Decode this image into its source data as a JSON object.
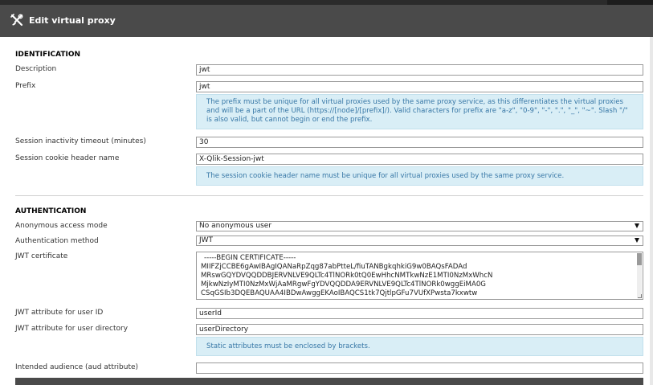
{
  "window": {
    "title": "Edit virtual proxy"
  },
  "identification": {
    "header": "IDENTIFICATION",
    "description_label": "Description",
    "description_value": "jwt",
    "prefix_label": "Prefix",
    "prefix_value": "jwt",
    "prefix_info": "The prefix must be unique for all virtual proxies used by the same proxy service, as this differentiates the virtual proxies and will be a part of the URL (https://[node]/[prefix]/). Valid characters for prefix are \"a-z\", \"0-9\", \"-\", \".\", \"_\", \"~\". Slash \"/\" is also valid, but cannot begin or end the prefix.",
    "session_timeout_label": "Session inactivity timeout (minutes)",
    "session_timeout_value": "30",
    "cookie_header_label": "Session cookie header name",
    "cookie_header_value": "X-Qlik-Session-jwt",
    "cookie_header_info": "The session cookie header name must be unique for all virtual proxies used by the same proxy service."
  },
  "authentication": {
    "header": "AUTHENTICATION",
    "anonymous_label": "Anonymous access mode",
    "anonymous_value": "No anonymous user",
    "method_label": "Authentication method",
    "method_value": "JWT",
    "certificate_label": "JWT certificate",
    "certificate_lines": [
      "-----BEGIN CERTIFICATE-----",
      "MIIFZjCCBE6gAwIBAgIQANaRpZqg87abPtteL/fiuTANBgkqhkiG9w0BAQsFADAd",
      "MRswGQYDVQQDDBJERVNLVE9QLTc4TlNORk0tQ0EwHhcNMTkwNzE1MTI0NzMxWhcN",
      "MjkwNzIyMTI0NzMxWjAaMRgwFgYDVQQDDA9ERVNLVE9QLTc4TlNORk0wggEiMA0G",
      "CSqGSIb3DQEBAQUAA4IBDwAwggEKAoIBAQCS1tk7QjtlpGFu7VUfXPwsta7kxwtw"
    ],
    "user_id_label": "JWT attribute for user ID",
    "user_id_value": "userId",
    "user_dir_label": "JWT attribute for user directory",
    "user_dir_value": "userDirectory",
    "user_dir_info": "Static attributes must be enclosed by brackets.",
    "audience_label": "Intended audience (aud attribute)",
    "audience_value": ""
  },
  "colors": {
    "titlebar": "#4a4a4a",
    "info_bg": "#d9eef6",
    "info_text": "#3777a6"
  },
  "icons": {
    "title_icon": "tools-icon",
    "dropdown": "chevron-down-icon"
  }
}
